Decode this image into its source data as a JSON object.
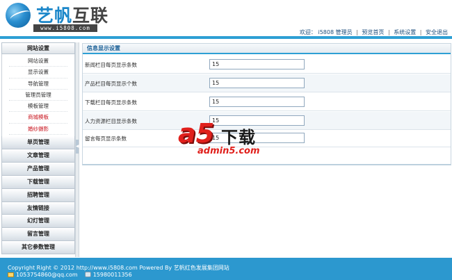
{
  "logo": {
    "part1": "艺帆",
    "part2": "互联",
    "url": "www.i5808.com"
  },
  "topnav": {
    "welcome": "欢迎：",
    "user": "i5808",
    "role": "管理员",
    "links": [
      "预览首页",
      "系统设置",
      "安全退出"
    ]
  },
  "sidebar": {
    "head": "网站设置",
    "sub_items": [
      {
        "label": "网站设置",
        "highlight": false
      },
      {
        "label": "显示设置",
        "highlight": false
      },
      {
        "label": "导航管理",
        "highlight": false
      },
      {
        "label": "管理员管理",
        "highlight": false
      },
      {
        "label": "模板管理",
        "highlight": false
      },
      {
        "label": "商城模板",
        "highlight": true
      },
      {
        "label": "婚纱摄影",
        "highlight": true
      }
    ],
    "groups": [
      "单页管理",
      "文章管理",
      "产品管理",
      "下载管理",
      "招聘管理",
      "友情链接",
      "幻灯管理",
      "留言管理",
      "其它参数管理"
    ]
  },
  "panel": {
    "title": "信息显示设置",
    "rows": [
      {
        "label": "新闻栏目每页显示条数",
        "value": "15"
      },
      {
        "label": "产品栏目每页显示个数",
        "value": "15"
      },
      {
        "label": "下载栏目每页显示条数",
        "value": "15"
      },
      {
        "label": "人力资源栏目显示条数",
        "value": "15"
      },
      {
        "label": "留言每页显示条数",
        "value": "15"
      }
    ]
  },
  "watermark": {
    "a5": "a5",
    "text": "下载",
    "domain": "admin5.com"
  },
  "footer": {
    "copyright": "Copyright Right © 2012 http://www.i5808.com Powered By 艺帆红色发展集团网站",
    "email": "1053754860@qq.com",
    "phone": "15980011356"
  },
  "colors": {
    "accent": "#2d9fd4",
    "footer_bg": "#2c98cf",
    "highlight": "#c8141e",
    "watermark": "#e0201c"
  }
}
